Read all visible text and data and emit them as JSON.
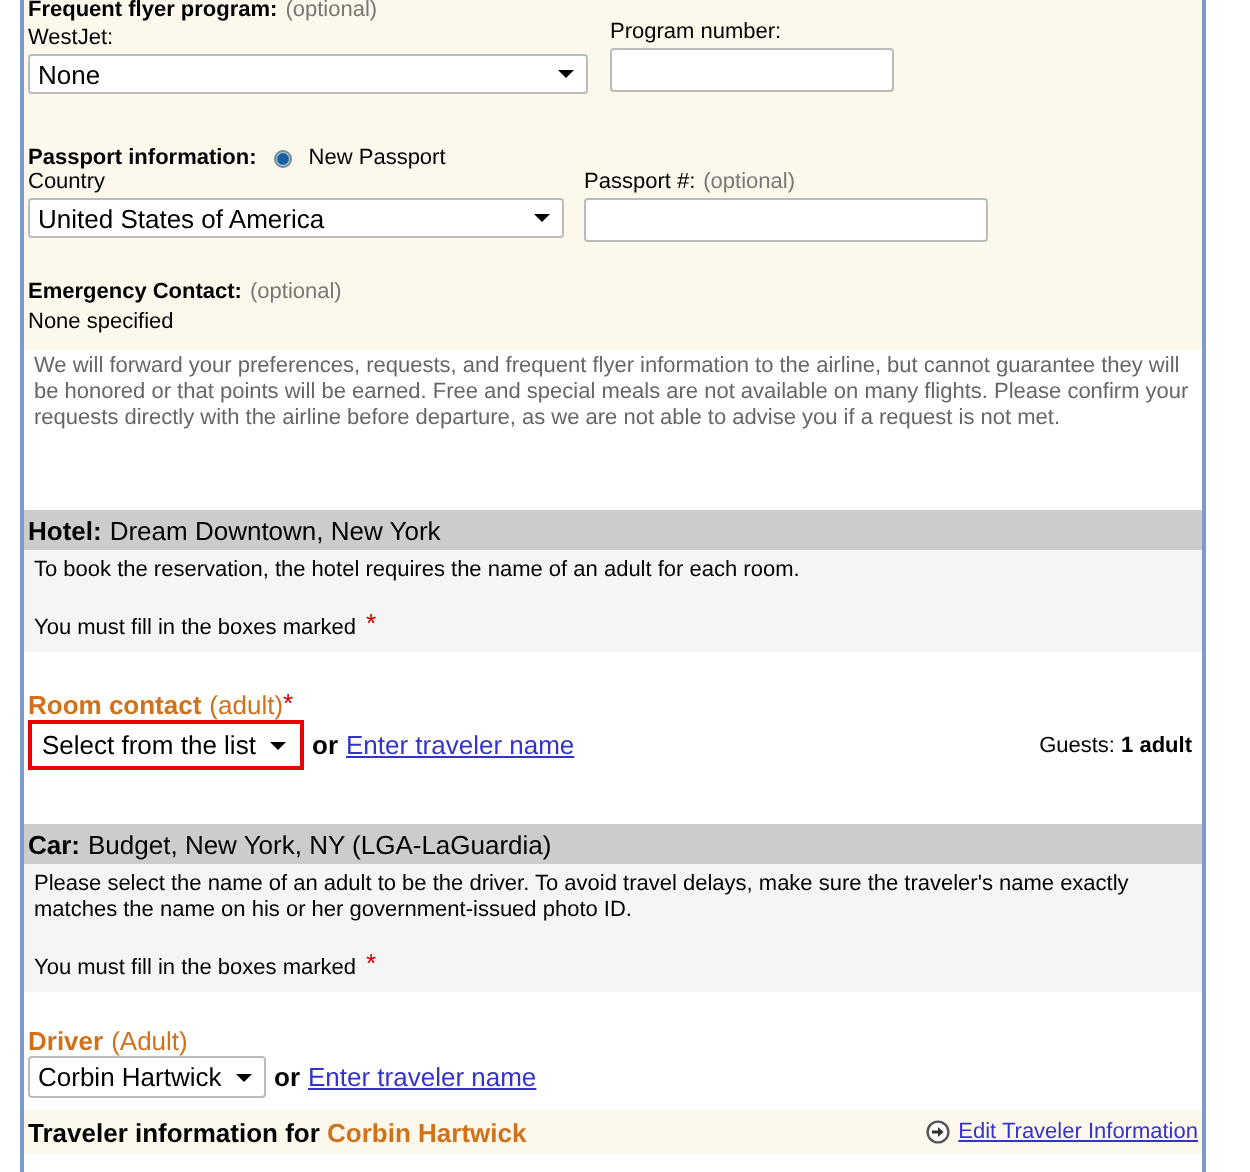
{
  "traveler": {
    "frequent_flyer": {
      "label": "Frequent flyer program:",
      "note": "(optional)",
      "airline_label": "WestJet:",
      "airline_value": "None",
      "number_label": "Program number:"
    },
    "passport": {
      "label": "Passport information:",
      "options": [
        {
          "label": "New Passport",
          "selected": true
        }
      ],
      "country_label": "Country",
      "country_value": "United States of America",
      "number_label": "Passport #:",
      "number_note": "(optional)"
    },
    "emergency": {
      "label": "Emergency Contact:",
      "note": "(optional)",
      "value": "None specified"
    }
  },
  "notice": "We will forward your preferences, requests, and frequent flyer information to the airline, but cannot guarantee they will be honored or that points will be earned. Free and special meals are not available on many flights. Please confirm your requests directly with the airline before departure, as we are not able to advise you if a request is not met.",
  "sections": [
    {
      "heading_label": "Hotel:",
      "heading_value": "Dream Downtown, New York",
      "info": [
        "To book the reservation, the hotel requires the name of an adult for each room.",
        "You must fill in the boxes marked"
      ],
      "info_mark": "*",
      "field_label": "Room contact",
      "field_note": "(adult)",
      "field_mark": "*",
      "highlighted": true,
      "select_value": "Select from the list",
      "or": "or",
      "link": "Enter traveler name",
      "guests_label": "Guests:",
      "guests_value": "1 adult"
    },
    {
      "heading_label": "Car:",
      "heading_value": "Budget, New York, NY (LGA-LaGuardia)",
      "info": [
        "Please select the name of an adult to be the driver. To avoid travel delays, make sure the traveler's name exactly matches the name on his or her government-issued photo ID.",
        "You must fill in the boxes marked"
      ],
      "info_mark": "*",
      "field_label": "Driver",
      "field_note": "(Adult)",
      "highlighted": false,
      "select_value": "Corbin Hartwick",
      "or": "or",
      "link": "Enter traveler name"
    }
  ],
  "traveler_bar": {
    "label": "Traveler information for",
    "name": "Corbin Hartwick",
    "link": "Edit Traveler Information"
  }
}
